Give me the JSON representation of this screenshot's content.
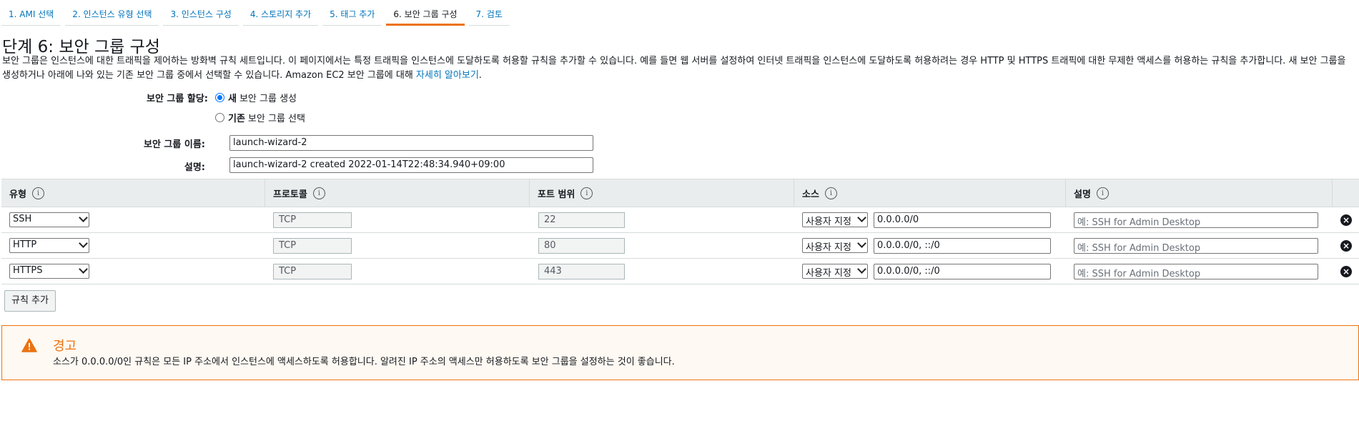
{
  "tabs": [
    {
      "label": "1. AMI 선택"
    },
    {
      "label": "2. 인스턴스 유형 선택"
    },
    {
      "label": "3. 인스턴스 구성"
    },
    {
      "label": "4. 스토리지 추가"
    },
    {
      "label": "5. 태그 추가"
    },
    {
      "label": "6. 보안 그룹 구성"
    },
    {
      "label": "7. 검토"
    }
  ],
  "page_title": "단계 6: 보안 그룹 구성",
  "description": {
    "text": "보안 그룹은 인스턴스에 대한 트래픽을 제어하는 방화벽 규칙 세트입니다. 이 페이지에서는 특정 트래픽을 인스턴스에 도달하도록 허용할 규칙을 추가할 수 있습니다. 예를 들면 웹 서버를 설정하여 인터넷 트래픽을 인스턴스에 도달하도록 허용하려는 경우 HTTP 및 HTTPS 트래픽에 대한 무제한 액세스를 허용하는 규칙을 추가합니다. 새 보안 그룹을 생성하거나 아래에 나와 있는 기존 보안 그룹 중에서 선택할 수 있습니다. Amazon EC2 보안 그룹에 대해 ",
    "link": "자세히 알아보기",
    "end": "."
  },
  "assign": {
    "label": "보안 그룹 할당:",
    "option_new_bold": "새",
    "option_new_rest": "보안 그룹 생성",
    "option_existing_bold": "기존",
    "option_existing_rest": "보안 그룹 선택"
  },
  "group_name": {
    "label": "보안 그룹 이름:",
    "value": "launch-wizard-2"
  },
  "group_desc": {
    "label": "설명:",
    "value": "launch-wizard-2 created 2022-01-14T22:48:34.940+09:00"
  },
  "table": {
    "headers": {
      "type": "유형",
      "protocol": "프로토콜",
      "port": "포트 범위",
      "source": "소스",
      "description": "설명"
    },
    "info_glyph": "i",
    "rows": [
      {
        "type": "SSH",
        "protocol": "TCP",
        "port": "22",
        "source_type": "사용자 지정",
        "source": "0.0.0.0/0",
        "desc_placeholder": "예: SSH for Admin Desktop"
      },
      {
        "type": "HTTP",
        "protocol": "TCP",
        "port": "80",
        "source_type": "사용자 지정",
        "source": "0.0.0.0/0, ::/0",
        "desc_placeholder": "예: SSH for Admin Desktop"
      },
      {
        "type": "HTTPS",
        "protocol": "TCP",
        "port": "443",
        "source_type": "사용자 지정",
        "source": "0.0.0.0/0, ::/0",
        "desc_placeholder": "예: SSH for Admin Desktop"
      }
    ],
    "remove_glyph": "×"
  },
  "add_rule_label": "규칙 추가",
  "warning": {
    "title": "경고",
    "text": "소스가 0.0.0.0/0인 규칙은 모든 IP 주소에서 인스턴스에 액세스하도록 허용합니다. 알려진 IP 주소의 액세스만 허용하도록 보안 그룹을 설정하는 것이 좋습니다."
  },
  "colors": {
    "accent": "#ec7211",
    "link": "#0073bb",
    "warning_bg": "#fef9f2"
  }
}
